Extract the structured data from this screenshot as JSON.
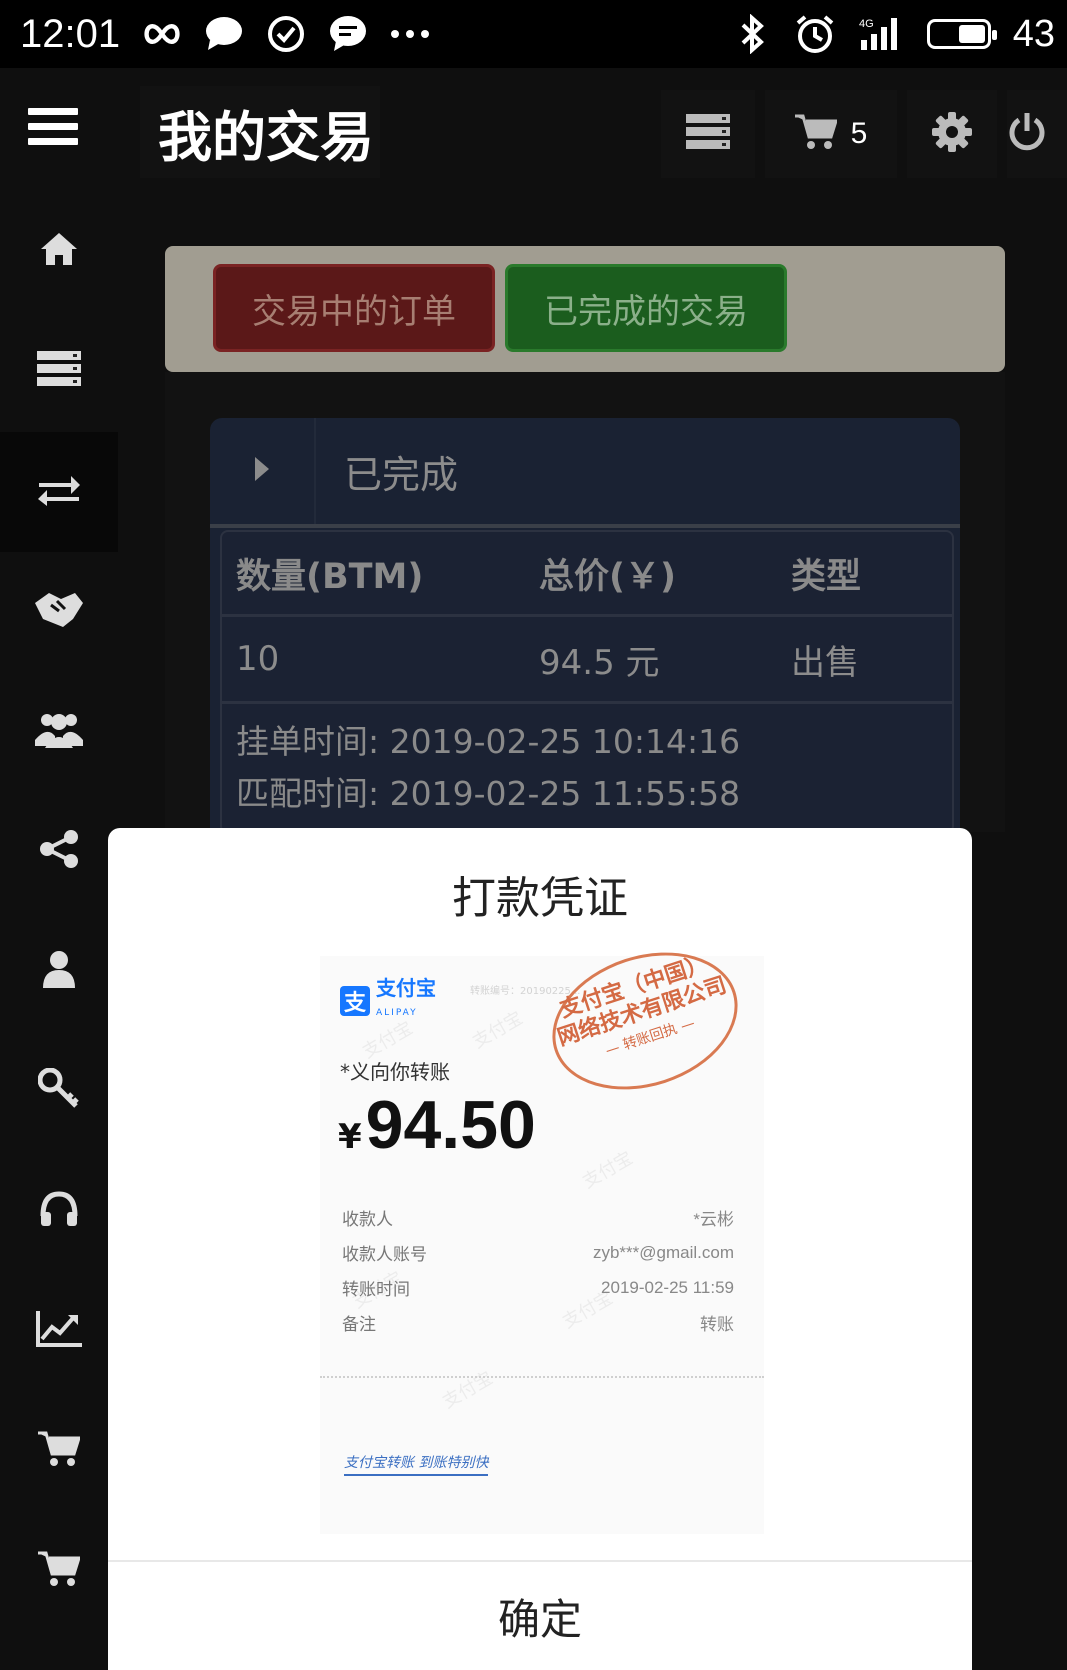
{
  "status_bar": {
    "time": "12:01",
    "battery_pct": "43",
    "network": "4G",
    "icons_left": [
      "infinity-icon",
      "chat-bubble-icon",
      "check-circle-icon",
      "message-icon",
      "more-dots-icon"
    ],
    "icons_right": [
      "bluetooth-icon",
      "alarm-icon",
      "signal-icon",
      "battery-icon"
    ]
  },
  "header": {
    "title": "我的交易",
    "cart_count": "5",
    "icons": [
      "menu-icon",
      "list-icon",
      "cart-icon",
      "gear-icon",
      "power-icon"
    ]
  },
  "sidebar": {
    "items": [
      {
        "icon": "home-icon"
      },
      {
        "icon": "list-icon"
      },
      {
        "icon": "exchange-icon",
        "active": true
      },
      {
        "icon": "handshake-icon"
      },
      {
        "icon": "users-icon"
      },
      {
        "icon": "share-icon"
      },
      {
        "icon": "user-icon"
      },
      {
        "icon": "key-icon"
      },
      {
        "icon": "headphones-icon"
      },
      {
        "icon": "chart-icon"
      },
      {
        "icon": "cart-icon"
      },
      {
        "icon": "cart-icon"
      }
    ]
  },
  "tabs": {
    "pending_label": "交易中的订单",
    "completed_label": "已完成的交易"
  },
  "panel": {
    "title": "已完成",
    "columns": [
      "数量(BTM)",
      "总价(￥)",
      "类型"
    ],
    "row": [
      "10",
      "94.5 元",
      "出售"
    ],
    "listed_time": "挂单时间: 2019-02-25 10:14:16",
    "matched_time": "匹配时间: 2019-02-25 11:55:58"
  },
  "modal": {
    "title": "打款凭证",
    "confirm_label": "确定",
    "receipt": {
      "brand": "支付宝",
      "brand_sub": "ALIPAY",
      "serial_label": "转账编号：20190225...",
      "stamp_line1": "支付宝（中国）",
      "stamp_line2": "网络技术有限公司",
      "stamp_line3": "— 转账回执 —",
      "from_text": "*义向你转账",
      "currency": "¥",
      "amount": "94.50",
      "rows": [
        {
          "label": "收款人",
          "value": "*云彬"
        },
        {
          "label": "收款人账号",
          "value": "zyb***@gmail.com"
        },
        {
          "label": "转账时间",
          "value": "2019-02-25 11:59"
        },
        {
          "label": "备注",
          "value": "转账"
        }
      ],
      "slogan": "支付宝转账 到账特别快"
    }
  }
}
